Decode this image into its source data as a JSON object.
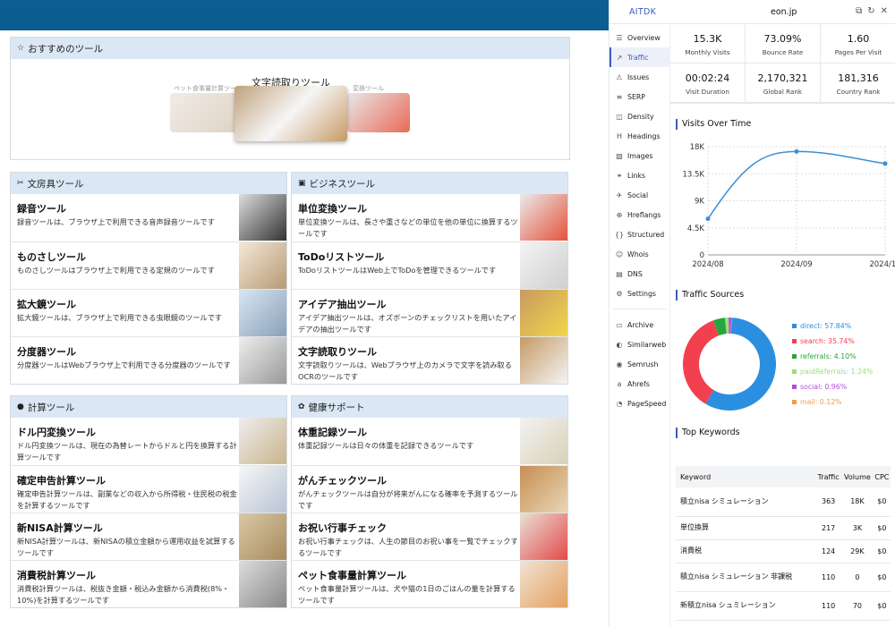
{
  "site": {
    "recommend": {
      "title": "おすすめのツール",
      "center_title": "文字読取りツール",
      "left_caption": "ペット食事量計算ツール",
      "right_caption": "変換ツール"
    },
    "stationery": {
      "title": "文房具ツール",
      "items": [
        {
          "name": "録音ツール",
          "desc": "録音ツールは、ブラウザ上で利用できる音声録音ツールです"
        },
        {
          "name": "ものさしツール",
          "desc": "ものさしツールはブラウザ上で利用できる定規のツールです"
        },
        {
          "name": "拡大鏡ツール",
          "desc": "拡大鏡ツールは、ブラウザ上で利用できる虫眼鏡のツールです"
        },
        {
          "name": "分度器ツール",
          "desc": "分度器ツールはWebブラウザ上で利用できる分度器のツールです"
        }
      ]
    },
    "business": {
      "title": "ビジネスツール",
      "items": [
        {
          "name": "単位変換ツール",
          "desc": "単位変換ツールは、長さや重さなどの単位を他の単位に換算するツールです"
        },
        {
          "name": "ToDoリストツール",
          "desc": "ToDoリストツールはWeb上でToDoを管理できるツールです"
        },
        {
          "name": "アイデア抽出ツール",
          "desc": "アイデア抽出ツールは、オズボーンのチェックリストを用いたアイデアの抽出ツールです"
        },
        {
          "name": "文字読取りツール",
          "desc": "文字読取りツールは、Webブラウザ上のカメラで文字を読み取るOCRのツールです"
        }
      ]
    },
    "calc": {
      "title": "計算ツール",
      "items": [
        {
          "name": "ドル円変換ツール",
          "desc": "ドル円変換ツールは、現在の為替レートからドルと円を換算する計算ツールです"
        },
        {
          "name": "確定申告計算ツール",
          "desc": "確定申告計算ツールは、副業などの収入から所得税・住民税の税金を計算するツールです"
        },
        {
          "name": "新NISA計算ツール",
          "desc": "新NISA計算ツールは、新NISAの積立金額から運用収益を試算するツールです"
        },
        {
          "name": "消費税計算ツール",
          "desc": "消費税計算ツールは、税抜き金額・税込み金額から消費税(8%・10%)を計算するツールです"
        }
      ]
    },
    "health": {
      "title": "健康サポート",
      "items": [
        {
          "name": "体重記録ツール",
          "desc": "体重記録ツールは日々の体重を記録できるツールです"
        },
        {
          "name": "がんチェックツール",
          "desc": "がんチェックツールは自分が将来がんになる確率を予測するツールです"
        },
        {
          "name": "お祝い行事チェック",
          "desc": "お祝い行事チェックは、人生の節目のお祝い事を一覧でチェックするツールです"
        },
        {
          "name": "ペット食事量計算ツール",
          "desc": "ペット食事量計算ツールは、犬や猫の1日のごはんの量を計算するツールです"
        }
      ]
    }
  },
  "ext": {
    "brand": "AITDK",
    "domain": "eon.jp",
    "nav": [
      {
        "label": "Overview",
        "icon": "grid-icon"
      },
      {
        "label": "Traffic",
        "icon": "chart-icon",
        "active": true
      },
      {
        "label": "Issues",
        "icon": "warning-icon"
      },
      {
        "label": "SERP",
        "icon": "list-icon"
      },
      {
        "label": "Density",
        "icon": "density-icon"
      },
      {
        "label": "Headings",
        "icon": "heading-icon"
      },
      {
        "label": "Images",
        "icon": "image-icon"
      },
      {
        "label": "Links",
        "icon": "link-icon"
      },
      {
        "label": "Social",
        "icon": "bird-icon"
      },
      {
        "label": "Hreflangs",
        "icon": "globe-icon"
      },
      {
        "label": "Structured",
        "icon": "braces-icon"
      },
      {
        "label": "Whois",
        "icon": "user-icon"
      },
      {
        "label": "DNS",
        "icon": "server-icon"
      },
      {
        "label": "Settings",
        "icon": "gear-icon"
      }
    ],
    "nav2": [
      {
        "label": "Archive",
        "icon": "archive-icon"
      },
      {
        "label": "Similarweb",
        "icon": "similarweb-icon"
      },
      {
        "label": "Semrush",
        "icon": "semrush-icon"
      },
      {
        "label": "Ahrefs",
        "icon": "ahrefs-icon"
      },
      {
        "label": "PageSpeed",
        "icon": "speed-icon"
      }
    ],
    "stats": [
      {
        "value": "15.3K",
        "label": "Monthly Visits"
      },
      {
        "value": "73.09%",
        "label": "Bounce Rate"
      },
      {
        "value": "1.60",
        "label": "Pages Per Visit"
      },
      {
        "value": "00:02:24",
        "label": "Visit Duration"
      },
      {
        "value": "2,170,321",
        "label": "Global Rank"
      },
      {
        "value": "181,316",
        "label": "Country Rank"
      }
    ],
    "visits_title": "Visits Over Time",
    "sources_title": "Traffic Sources",
    "keywords_title": "Top Keywords",
    "kw_headers": [
      "Keyword",
      "Traffic",
      "Volume",
      "CPC"
    ],
    "keywords": [
      [
        "積立nisa シミュレーション",
        "363",
        "18K",
        "$0"
      ],
      [
        "単位換算",
        "217",
        "3K",
        "$0"
      ],
      [
        "消費税",
        "124",
        "29K",
        "$0"
      ],
      [
        "積立nisa シミュレーション 非課税",
        "110",
        "0",
        "$0"
      ],
      [
        "新積立nisa シュミレーション",
        "110",
        "70",
        "$0"
      ]
    ]
  },
  "chart_data": [
    {
      "type": "line",
      "x": [
        "2024/08",
        "2024/09",
        "2024/10"
      ],
      "values": [
        6000,
        17200,
        15200
      ],
      "ylim": [
        0,
        18000
      ],
      "yticks": [
        "0",
        "4.5K",
        "9K",
        "13.5K",
        "18K"
      ],
      "grid": true,
      "title": "Visits Over Time"
    },
    {
      "type": "pie",
      "title": "Traffic Sources",
      "labels": [
        "direct",
        "search",
        "referrals",
        "paidReferrals",
        "social",
        "mail"
      ],
      "values": [
        57.84,
        35.74,
        4.1,
        1.24,
        0.96,
        0.12
      ],
      "display": [
        "direct: 57.84%",
        "search: 35.74%",
        "referrals: 4.10%",
        "paidReferrals: 1.24%",
        "social: 0.96%",
        "mail: 0.12%"
      ],
      "colors": [
        "#2b8fe0",
        "#f2404f",
        "#27a63d",
        "#9be07a",
        "#b24ee0",
        "#f29c4a"
      ]
    }
  ]
}
